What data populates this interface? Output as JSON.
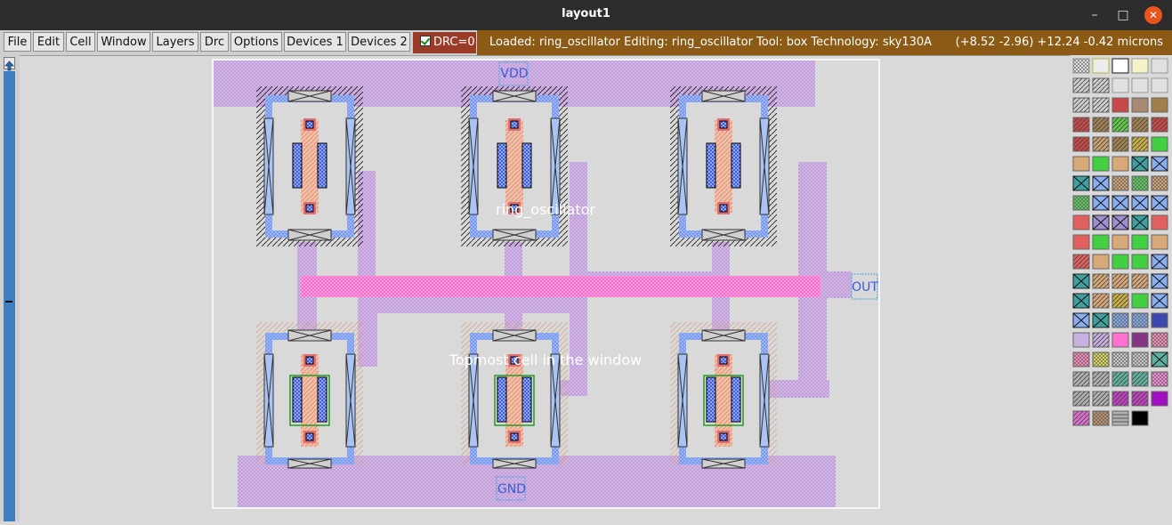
{
  "window": {
    "title": "layout1"
  },
  "menu": {
    "items": [
      "File",
      "Edit",
      "Cell",
      "Window",
      "Layers",
      "Drc",
      "Options",
      "Devices 1",
      "Devices 2"
    ],
    "drc_label": "DRC=0"
  },
  "status": {
    "info": "Loaded: ring_oscillator Editing: ring_oscillator Tool: box  Technology: sky130A",
    "coords": "(+8.52 -2.96) +12.24 -0.42 microns"
  },
  "layout": {
    "cell_name": "ring_oscillator",
    "cell_note": "Topmost cell in the window",
    "labels": {
      "vdd": "VDD",
      "gnd": "GND",
      "out": "OUT"
    }
  },
  "colors": {
    "title_bg": "#2c2c2c",
    "status_bg": "#8b5a14",
    "drc_bg": "#9a3b28",
    "scrollbar": "#3e7fbf",
    "canvas_bg": "#d9d9d9",
    "metal1": "#c8a8e0",
    "local_interconnect": "#8aaef0",
    "poly": "#e8a088",
    "metal2": "#ff80d0",
    "diffusion": "#4060d8"
  }
}
